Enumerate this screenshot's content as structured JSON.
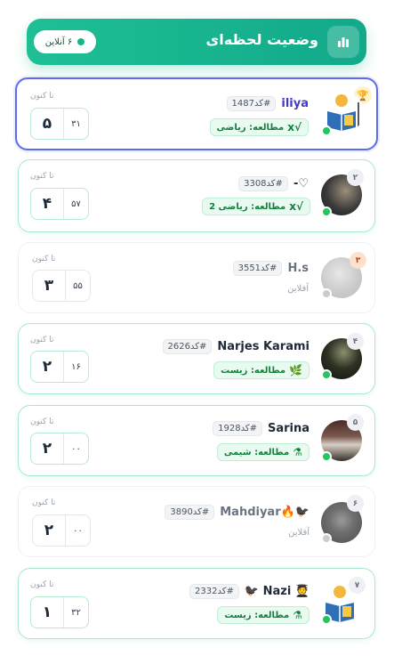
{
  "header": {
    "title": "وضعیت لحظه‌ای",
    "online_count": "۶ آنلاین",
    "icon": "bar-chart-icon",
    "accent": "#14b08c"
  },
  "so_far_label": "تا کنون",
  "users": [
    {
      "rank": "",
      "name": "iliya",
      "code": "#کد1487",
      "status": "online",
      "study": "مطالعه: ریاضی",
      "study_icon": "√x",
      "big": "۵",
      "small": "۳۱",
      "trophy": "🏆"
    },
    {
      "rank": "۲",
      "name": "♡-",
      "code": "#کد3308",
      "status": "online",
      "study": "مطالعه: ریاضی 2",
      "study_icon": "√x",
      "big": "۴",
      "small": "۵۷"
    },
    {
      "rank": "۳",
      "name": "H.s",
      "code": "#کد3551",
      "status": "offline",
      "status_text": "آفلاین",
      "big": "۳",
      "small": "۵۵"
    },
    {
      "rank": "۴",
      "name": "Narjes Karami",
      "code": "#کد2626",
      "status": "online",
      "study": "مطالعه: زیست",
      "study_icon": "🌿",
      "big": "۲",
      "small": "۱۶"
    },
    {
      "rank": "۵",
      "name": "Sarina",
      "code": "#کد1928",
      "status": "online",
      "study": "مطالعه: شیمی",
      "study_icon": "⚗",
      "big": "۲",
      "small": "۰۰"
    },
    {
      "rank": "۶",
      "name": "🐦‍⬛🔥Mahdiyar",
      "code": "#کد3890",
      "status": "offline",
      "status_text": "آفلاین",
      "big": "۲",
      "small": "۰۰"
    },
    {
      "rank": "۷",
      "name": "🧑‍🎓 Nazi 🐦‍⬛",
      "code": "#کد2332",
      "status": "online",
      "study": "مطالعه: زیست",
      "study_icon": "⚗",
      "big": "۱",
      "small": "۳۲"
    }
  ]
}
